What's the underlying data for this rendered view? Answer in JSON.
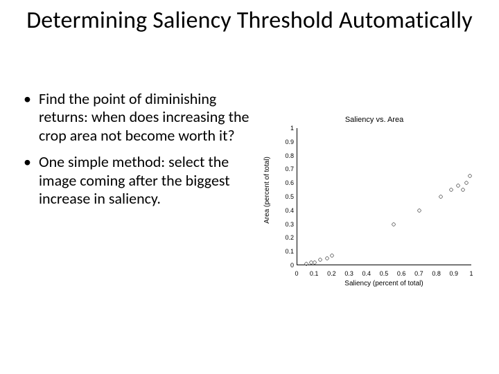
{
  "title": "Determining Saliency Threshold Automatically",
  "bullets": [
    "Find the point of diminishing returns: when does increasing the crop area not become worth it?",
    "One simple method: select the image coming after the biggest increase in saliency."
  ],
  "chart_data": {
    "type": "scatter",
    "title": "Saliency vs. Area",
    "xlabel": "Saliency (percent of total)",
    "ylabel": "Area (percent of total)",
    "xlim": [
      0,
      1
    ],
    "ylim": [
      0,
      1
    ],
    "xticks": [
      0,
      0.1,
      0.2,
      0.3,
      0.4,
      0.5,
      0.6,
      0.7,
      0.8,
      0.9,
      1
    ],
    "yticks": [
      0,
      0.1,
      0.2,
      0.3,
      0.4,
      0.5,
      0.6,
      0.7,
      0.8,
      0.9,
      1
    ],
    "x": [
      0.05,
      0.08,
      0.1,
      0.13,
      0.17,
      0.2,
      0.55,
      0.7,
      0.82,
      0.88,
      0.92,
      0.95,
      0.97,
      0.99
    ],
    "y": [
      0.01,
      0.02,
      0.02,
      0.04,
      0.05,
      0.07,
      0.3,
      0.4,
      0.5,
      0.55,
      0.58,
      0.55,
      0.6,
      0.65
    ]
  }
}
